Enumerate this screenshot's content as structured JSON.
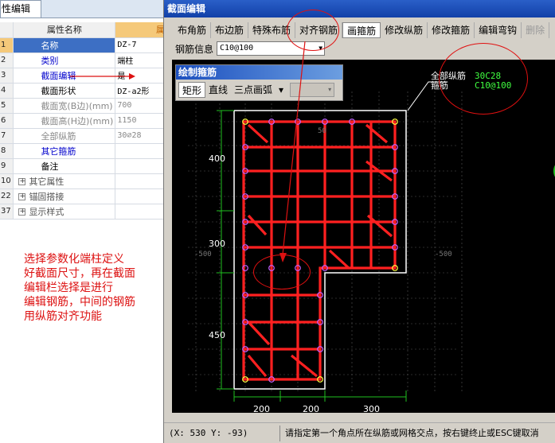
{
  "left_panel": {
    "tab_label": "性编辑",
    "header": {
      "col_name": "属性名称",
      "col_value": "属"
    },
    "rows": [
      {
        "num": "1",
        "name": "名称",
        "value": "DZ-7",
        "style": "hl",
        "value_style": ""
      },
      {
        "num": "2",
        "name": "类别",
        "value": "端柱",
        "style": "blue",
        "value_style": ""
      },
      {
        "num": "3",
        "name": "截面编辑",
        "value": "是",
        "style": "blue",
        "value_style": ""
      },
      {
        "num": "4",
        "name": "截面形状",
        "value": "DZ-a2形",
        "style": "",
        "value_style": ""
      },
      {
        "num": "5",
        "name": "截面宽(B边)(mm)",
        "value": "700",
        "style": "gray",
        "value_style": "gray"
      },
      {
        "num": "6",
        "name": "截面高(H边)(mm)",
        "value": "1150",
        "style": "gray",
        "value_style": "gray"
      },
      {
        "num": "7",
        "name": "全部纵筋",
        "value": "30⌀28",
        "style": "gray",
        "value_style": "gray"
      },
      {
        "num": "8",
        "name": "其它箍筋",
        "value": "",
        "style": "blue",
        "value_style": ""
      },
      {
        "num": "9",
        "name": "备注",
        "value": "",
        "style": "",
        "value_style": ""
      },
      {
        "num": "10",
        "name": "其它属性",
        "value": "",
        "style": "exp",
        "value_style": ""
      },
      {
        "num": "22",
        "name": "锚固搭接",
        "value": "",
        "style": "exp",
        "value_style": ""
      },
      {
        "num": "37",
        "name": "显示样式",
        "value": "",
        "style": "exp",
        "value_style": ""
      }
    ],
    "annotation": "选择参数化端柱定义\n好截面尺寸，再在截面\n编辑栏选择是进行\n编辑钢筋，中间的钢筋\n用纵筋对齐功能"
  },
  "dialog": {
    "title": "截面编辑",
    "toolbar": [
      "布角筋",
      "布边筋",
      "特殊布筋",
      "对齐钢筋",
      "画箍筋",
      "修改纵筋",
      "修改箍筋",
      "编辑弯钩",
      "删除"
    ],
    "rebar_info_label": "钢筋信息",
    "rebar_info_value": "C10@100",
    "draw_panel": {
      "title": "绘制箍筋",
      "tools": [
        "矩形",
        "直线",
        "三点画弧"
      ]
    },
    "legend": {
      "all_long_label": "全部纵筋",
      "all_long_value": "30C28",
      "stirrup_label": "箍筋",
      "stirrup_value": "C10@100"
    },
    "dims": {
      "left": [
        "400",
        "300",
        "450"
      ],
      "bottom": [
        "200",
        "200",
        "300"
      ],
      "axis_minus": "-500",
      "axis_top": "50"
    },
    "status": {
      "coord": "(X: 530 Y: -93)",
      "hint": "请指定第一个角点所在纵筋或网格交点，按右键终止或ESC键取消"
    }
  },
  "colors": {
    "rebar": "#ff2020",
    "outline": "#ffffff",
    "dim": "#20c020",
    "legend_value": "#40ff40",
    "annotation": "#dd1111"
  }
}
